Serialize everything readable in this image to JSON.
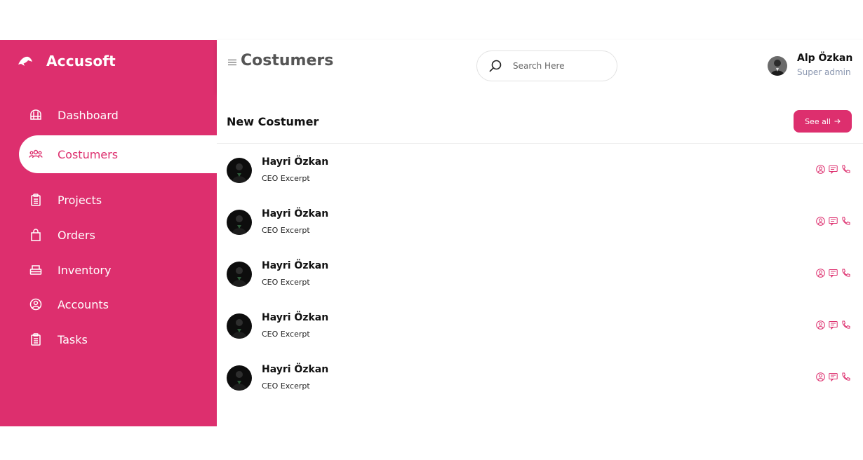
{
  "brand": {
    "name": "Accusoft"
  },
  "sidebar": {
    "items": [
      {
        "label": "Dashboard",
        "icon": "dashboard-icon",
        "active": false
      },
      {
        "label": "Costumers",
        "icon": "users-icon",
        "active": true
      },
      {
        "label": "Projects",
        "icon": "clipboard-icon",
        "active": false
      },
      {
        "label": "Orders",
        "icon": "shopping-bag-icon",
        "active": false
      },
      {
        "label": "Inventory",
        "icon": "inventory-icon",
        "active": false
      },
      {
        "label": "Accounts",
        "icon": "user-circle-icon",
        "active": false
      },
      {
        "label": "Tasks",
        "icon": "clipboard-icon",
        "active": false
      }
    ]
  },
  "header": {
    "title": "Costumers",
    "search_placeholder": "Search Here",
    "user": {
      "name": "Alp Özkan",
      "role": "Super admin"
    }
  },
  "section": {
    "title": "New Costumer",
    "see_all": "See all"
  },
  "customers": [
    {
      "name": "Hayri Özkan",
      "title": "CEO Excerpt"
    },
    {
      "name": "Hayri Özkan",
      "title": "CEO Excerpt"
    },
    {
      "name": "Hayri Özkan",
      "title": "CEO Excerpt"
    },
    {
      "name": "Hayri Özkan",
      "title": "CEO Excerpt"
    },
    {
      "name": "Hayri Özkan",
      "title": "CEO Excerpt"
    }
  ],
  "colors": {
    "accent": "#dd2f6e",
    "muted": "#8b97b0"
  }
}
